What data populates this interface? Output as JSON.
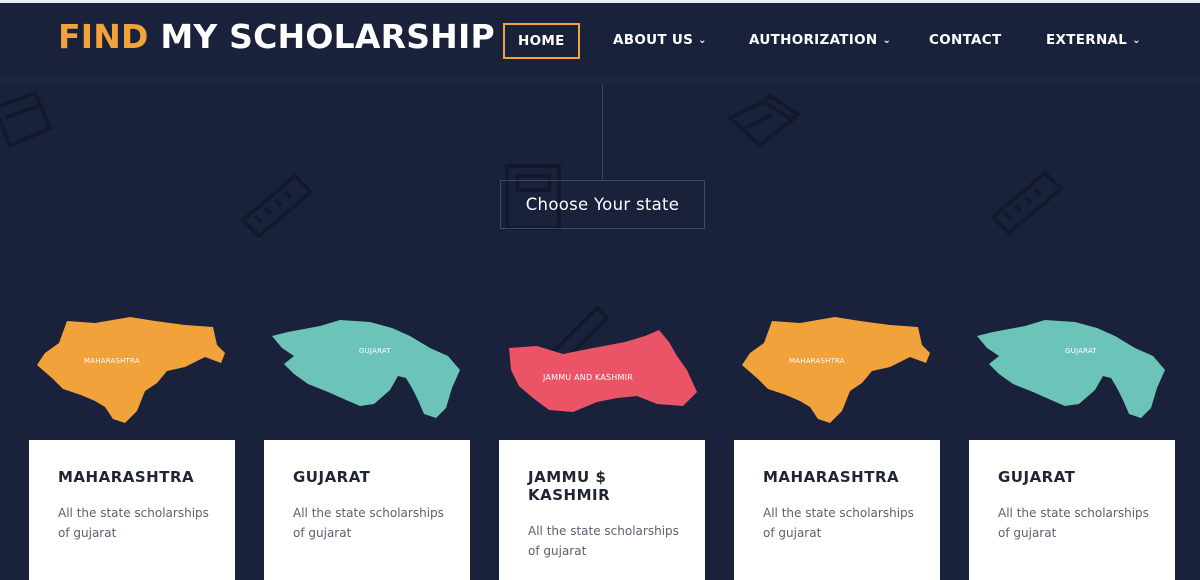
{
  "site": {
    "logo_part1": "FIND",
    "logo_part2": "MY SCHOLARSHIP"
  },
  "nav": {
    "items": [
      {
        "label": "HOME"
      },
      {
        "label": "ABOUT US"
      },
      {
        "label": "AUTHORIZATION"
      },
      {
        "label": "CONTACT"
      },
      {
        "label": "EXTERNAL"
      }
    ]
  },
  "hero": {
    "heading": "Choose Your state"
  },
  "maps": [
    {
      "label": "MAHARASHTRA",
      "color": "#f2a23a"
    },
    {
      "label": "GUJARAT",
      "color": "#6cc3b7"
    },
    {
      "label": "JAMMU AND KASHMIR",
      "color": "#ea5466"
    },
    {
      "label": "MAHARASHTRA",
      "color": "#f2a23a"
    },
    {
      "label": "GUJARAT",
      "color": "#6cc3b7"
    }
  ],
  "cards": [
    {
      "title": "MAHARASHTRA",
      "text": "All the state scholarships of gujarat"
    },
    {
      "title": "GUJARAT",
      "text": "All the state scholarships of gujarat"
    },
    {
      "title": "JAMMU $ KASHMIR",
      "text": "All the state scholarships of gujarat"
    },
    {
      "title": "MAHARASHTRA",
      "text": "All the state scholarships of gujarat"
    },
    {
      "title": "GUJARAT",
      "text": "All the state scholarships of gujarat"
    }
  ],
  "colors": {
    "accent": "#f2a23a",
    "background": "#19223a"
  },
  "icons": [
    "book-icon",
    "ruler-icon",
    "pencil-icon",
    "calculator-icon",
    "chevron-down-icon"
  ]
}
